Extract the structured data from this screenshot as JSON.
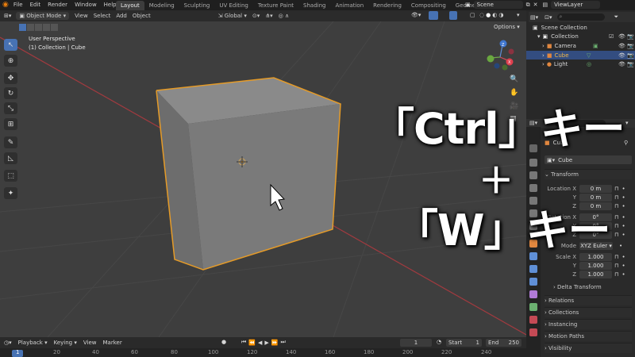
{
  "topbar": {
    "menu": [
      "File",
      "Edit",
      "Render",
      "Window",
      "Help"
    ],
    "workspaces": [
      "Layout",
      "Modeling",
      "Sculpting",
      "UV Editing",
      "Texture Paint",
      "Shading",
      "Animation",
      "Rendering",
      "Compositing",
      "Geometry Nodes"
    ],
    "active_workspace": "Layout",
    "scene": "Scene",
    "view_layer": "ViewLayer"
  },
  "viewport_header": {
    "mode": "Object Mode",
    "menus": [
      "View",
      "Select",
      "Add",
      "Object"
    ],
    "orientation": "Global",
    "options": "Options"
  },
  "viewport": {
    "perspective": "User Perspective",
    "collection_info": "(1) Collection | Cube"
  },
  "outliner": {
    "root": "Scene Collection",
    "collection": "Collection",
    "items": [
      {
        "label": "Camera",
        "selected": false
      },
      {
        "label": "Cube",
        "selected": true
      },
      {
        "label": "Light",
        "selected": false
      }
    ]
  },
  "properties": {
    "object_name": "Cube",
    "data_name": "Cube",
    "transform_title": "Transform",
    "location": {
      "label": "Location X",
      "x": "0 m",
      "y": "0 m",
      "z": "0 m"
    },
    "rotation": {
      "label": "Rotation X",
      "x": "0°",
      "y": "0°",
      "z": "0°"
    },
    "mode_label": "Mode",
    "mode_value": "XYZ Euler",
    "scale": {
      "label": "Scale X",
      "x": "1.000",
      "y": "1.000",
      "z": "1.000"
    },
    "axis_y": "Y",
    "axis_z": "Z",
    "panels": [
      "Delta Transform",
      "Relations",
      "Collections",
      "Instancing",
      "Motion Paths",
      "Visibility"
    ]
  },
  "timeline": {
    "menus": [
      "Playback",
      "Keying",
      "View",
      "Marker"
    ],
    "current_frame": "1",
    "start_label": "Start",
    "start": "1",
    "end_label": "End",
    "end": "250",
    "ticks": [
      "1",
      "20",
      "40",
      "60",
      "80",
      "100",
      "120",
      "140",
      "160",
      "180",
      "200",
      "220",
      "240"
    ]
  },
  "overlay": {
    "line1": "「Ctrl」キー",
    "plus": "＋",
    "line2": "「W」キー"
  },
  "colors": {
    "accent": "#4772b3",
    "selection_outline": "#e59b28",
    "cube_face_front": "#7a7a7a",
    "cube_face_top": "#8a8a8a",
    "cube_face_left": "#6c6c6c",
    "viewport_bg": "#3e3e3e"
  }
}
